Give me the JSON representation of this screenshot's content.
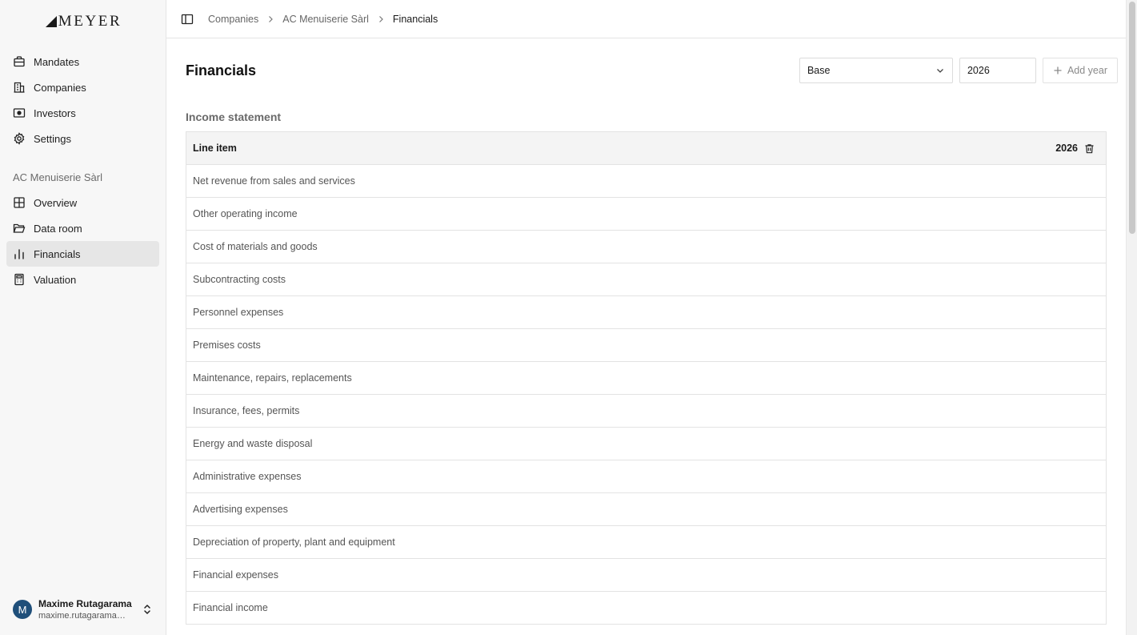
{
  "brand": {
    "logo_text": "MEYER"
  },
  "sidebar": {
    "main_nav": [
      {
        "label": "Mandates",
        "icon": "briefcase-icon"
      },
      {
        "label": "Companies",
        "icon": "building-icon"
      },
      {
        "label": "Investors",
        "icon": "banknote-icon"
      },
      {
        "label": "Settings",
        "icon": "gear-icon"
      }
    ],
    "company_section_label": "AC Menuiserie Sàrl",
    "company_nav": [
      {
        "label": "Overview",
        "icon": "grid-icon"
      },
      {
        "label": "Data room",
        "icon": "folder-icon"
      },
      {
        "label": "Financials",
        "icon": "bar-chart-icon",
        "active": true
      },
      {
        "label": "Valuation",
        "icon": "calculator-icon"
      }
    ],
    "user": {
      "initial": "M",
      "name": "Maxime Rutagarama",
      "email": "maxime.rutagarama@..."
    }
  },
  "breadcrumb": [
    "Companies",
    "AC Menuiserie Sàrl",
    "Financials"
  ],
  "page": {
    "title": "Financials",
    "scenario_value": "Base",
    "year_value": "2026",
    "add_year_label": "Add year"
  },
  "income_statement": {
    "title": "Income statement",
    "column_header": "Line item",
    "year_column": "2026",
    "rows": [
      "Net revenue from sales and services",
      "Other operating income",
      "Cost of materials and goods",
      "Subcontracting costs",
      "Personnel expenses",
      "Premises costs",
      "Maintenance, repairs, replacements",
      "Insurance, fees, permits",
      "Energy and waste disposal",
      "Administrative expenses",
      "Advertising expenses",
      "Depreciation of property, plant and equipment",
      "Financial expenses",
      "Financial income"
    ]
  },
  "colors": {
    "sidebar_bg": "#f7f7f7",
    "active_item_bg": "#e6e6e6",
    "avatar_bg": "#1f4f7a",
    "table_header_bg": "#f4f4f4",
    "border": "#e3e3e3"
  }
}
